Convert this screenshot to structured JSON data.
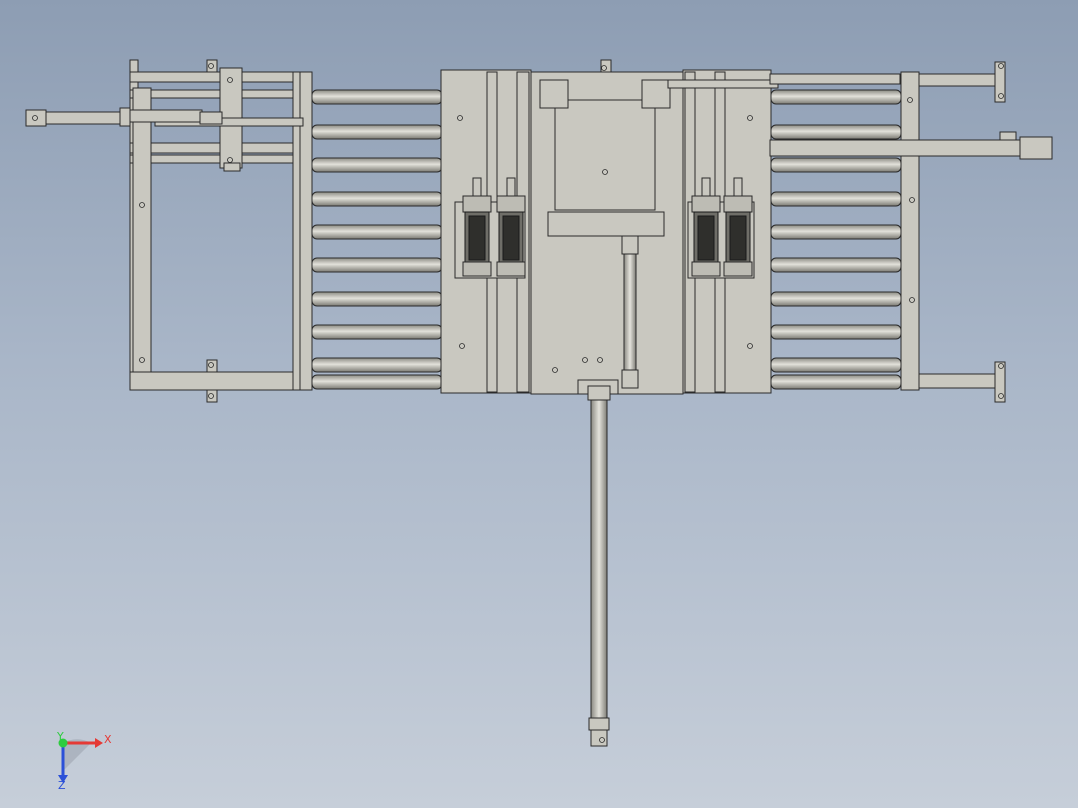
{
  "view": {
    "background_top": "#8d9db3",
    "background_bottom": "#c6ced9",
    "model_fill": "#c9c8c0",
    "model_stroke": "#2a2a2a",
    "roller_fill": "#b9b8b0"
  },
  "triad": {
    "x_label": "X",
    "y_label": "Y",
    "z_label": "Z",
    "x_color": "#e53935",
    "y_color": "#2ecc40",
    "z_color": "#2b50d8"
  },
  "assembly": {
    "left_roller_count": 10,
    "right_roller_count": 10,
    "cylinder_groups": 2
  }
}
